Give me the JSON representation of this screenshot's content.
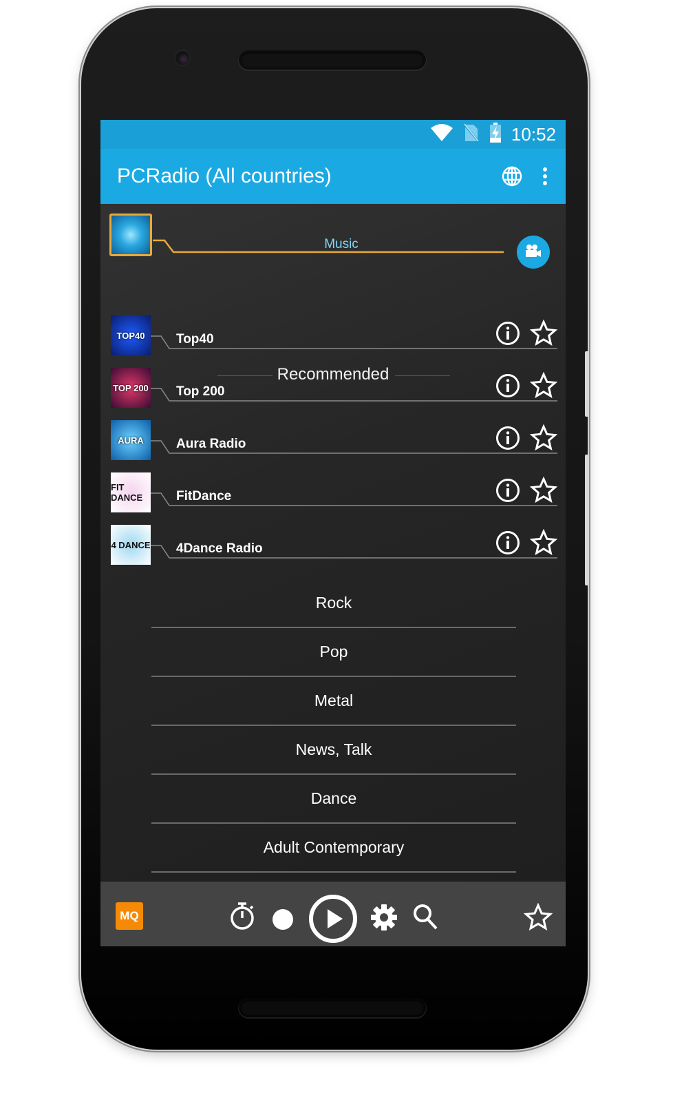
{
  "status_bar": {
    "time": "10:52",
    "icons": [
      "wifi-icon",
      "no-sim-icon",
      "battery-charging-icon"
    ]
  },
  "app_bar": {
    "title": "PCRadio (All countries)",
    "actions": [
      "globe-icon",
      "more-vert-icon"
    ]
  },
  "current_genre": {
    "label": "Music",
    "action_icon": "video-camera-icon"
  },
  "recommended": {
    "title": "Recommended",
    "stations": [
      {
        "name": "Top40",
        "thumb_text": "TOP40",
        "colors": [
          "#0a1d6e",
          "#1e5bff"
        ]
      },
      {
        "name": "Top 200",
        "thumb_text": "TOP 200",
        "colors": [
          "#3a0c34",
          "#e0386a"
        ]
      },
      {
        "name": "Aura Radio",
        "thumb_text": "AURA",
        "colors": [
          "#0b5ea8",
          "#6fd3ff"
        ]
      },
      {
        "name": "FitDance",
        "thumb_text": "FIT DANCE",
        "colors": [
          "#ffffff",
          "#f4d3ef"
        ]
      },
      {
        "name": "4Dance Radio",
        "thumb_text": "4 DANCE",
        "colors": [
          "#ffffff",
          "#9fd8f0"
        ]
      }
    ]
  },
  "categories": [
    "Rock",
    "Pop",
    "Metal",
    "News, Talk",
    "Dance",
    "Adult Contemporary"
  ],
  "player_bar": {
    "quality_label": "MQ",
    "controls": [
      "timer-icon",
      "record-icon",
      "play-icon",
      "settings-icon",
      "search-icon",
      "favorite-star-icon"
    ]
  },
  "colors": {
    "accent": "#1aa9e3",
    "status_bar": "#1a9fd6",
    "genre_line": "#e9a93a",
    "quality_badge": "#f58a07",
    "player_bar": "#444444"
  }
}
